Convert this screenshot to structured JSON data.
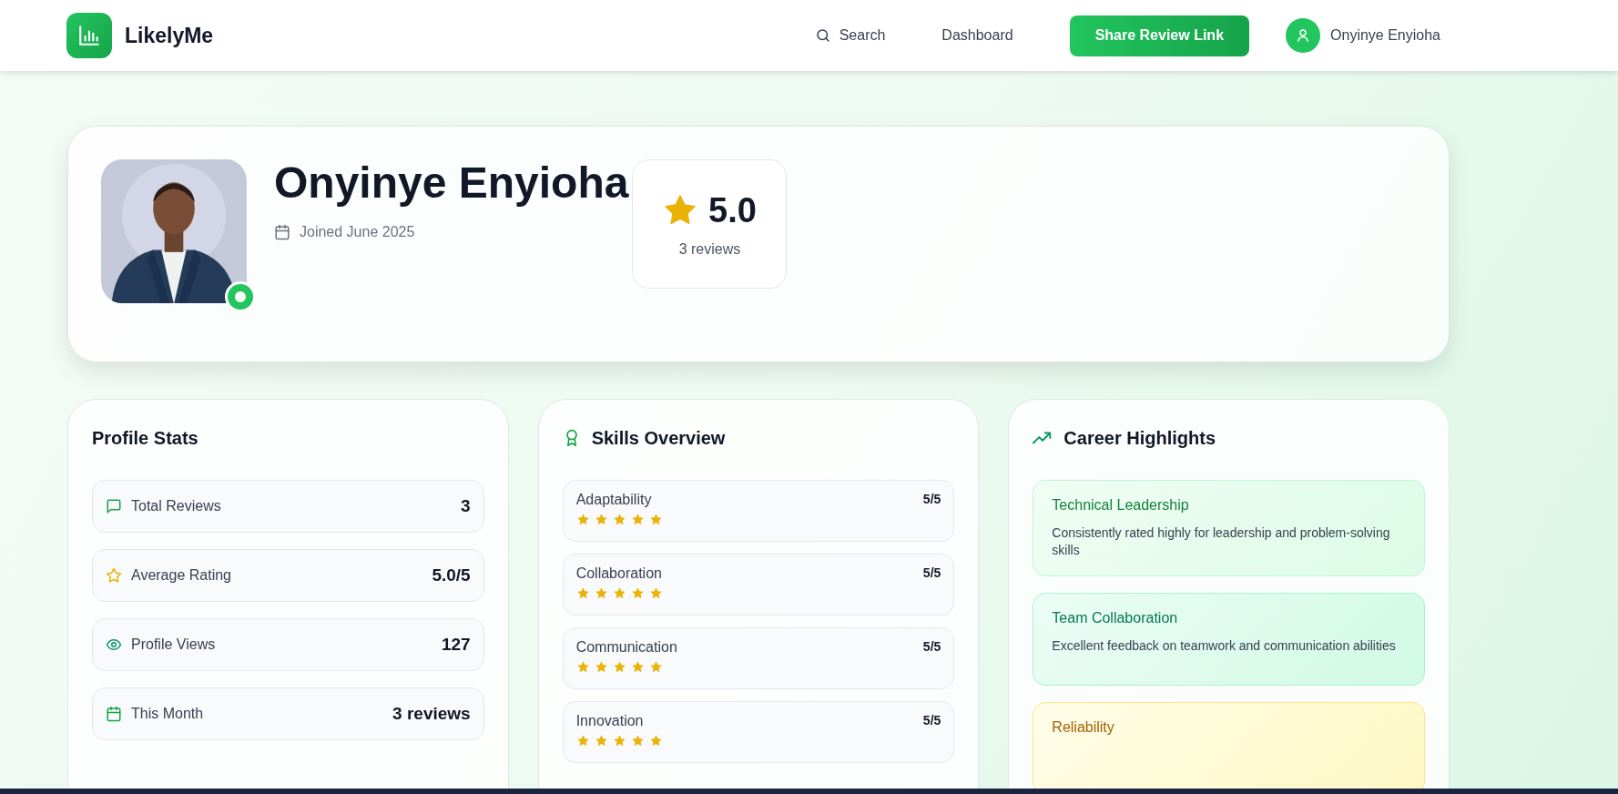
{
  "nav": {
    "brand": "LikelyMe",
    "links": [
      {
        "label": "Search",
        "kind": "search"
      },
      {
        "label": "Dashboard",
        "kind": "plain"
      }
    ],
    "share_button": "Share Review Link",
    "user": "Onyinye Enyioha"
  },
  "profile": {
    "name": "Onyinye Enyioha",
    "joined": "Joined June 2025",
    "online": true,
    "rating": "5.0",
    "reviews": "3 reviews"
  },
  "stats": {
    "title": "Profile Stats",
    "items": [
      {
        "kind": "message",
        "label": "Total Reviews",
        "value": "3"
      },
      {
        "kind": "star",
        "label": "Average Rating",
        "value": "5.0/5"
      },
      {
        "kind": "eye",
        "label": "Profile Views",
        "value": "127"
      },
      {
        "kind": "calendar",
        "label": "This Month",
        "value": "3 reviews"
      }
    ]
  },
  "skills": {
    "title": "Skills Overview",
    "items": [
      {
        "name": "Adaptability",
        "score": "5/5",
        "stars": 5
      },
      {
        "name": "Collaboration",
        "score": "5/5",
        "stars": 5
      },
      {
        "name": "Communication",
        "score": "5/5",
        "stars": 5
      },
      {
        "name": "Innovation",
        "score": "5/5",
        "stars": 5
      }
    ]
  },
  "highlights": {
    "title": "Career Highlights",
    "items": [
      {
        "kind": "green",
        "title": "Technical Leadership",
        "description": "Consistently rated highly for leadership and problem-solving skills"
      },
      {
        "kind": "teal",
        "title": "Team Collaboration",
        "description": "Excellent feedback on teamwork and communication abilities"
      },
      {
        "kind": "yellow",
        "title": "Reliability"
      }
    ]
  }
}
